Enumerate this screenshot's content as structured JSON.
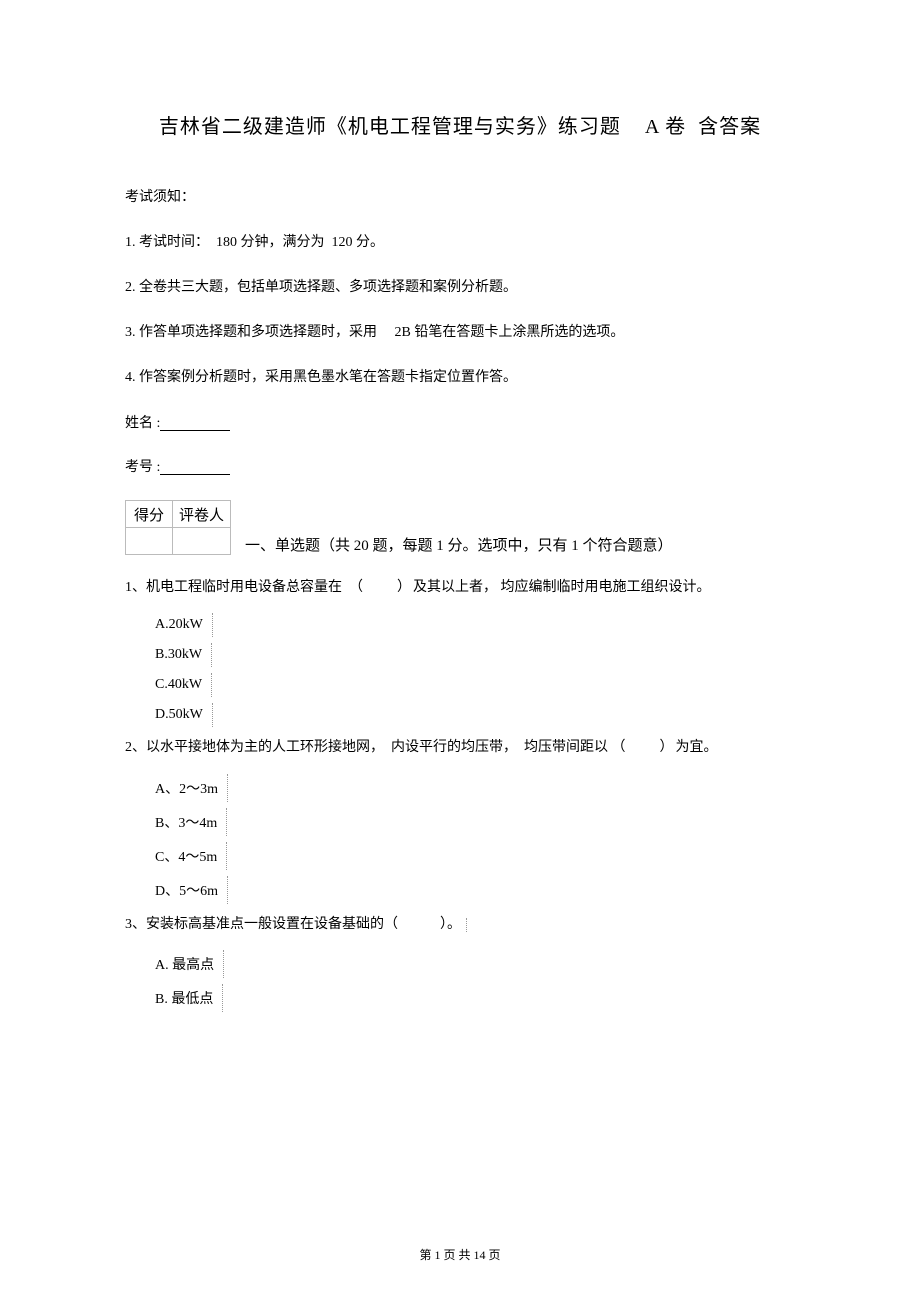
{
  "title_main": "吉林省二级建造师《机电工程管理与实务》练习题",
  "title_vol": "A 卷",
  "title_ans": "含答案",
  "notice_heading": "考试须知：",
  "notices": [
    {
      "prefix": "1. 考试时间：",
      "part1": "180 分钟，满分为",
      "part2": "120 分。"
    },
    {
      "text": "2. 全卷共三大题，包括单项选择题、多项选择题和案例分析题。"
    },
    {
      "prefix": "3. 作答单项选择题和多项选择题时，采用",
      "mid": "2B 铅笔在答题卡上涂黑所选的选项。"
    },
    {
      "text": "4. 作答案例分析题时，采用黑色墨水笔在答题卡指定位置作答。"
    }
  ],
  "name_label": "姓名 :",
  "id_label": "考号 :",
  "score_headers": [
    "得分",
    "评卷人"
  ],
  "section1_title": "一、单选题（共 20 题，每题 1 分。选项中，只有 1 个符合题意）",
  "questions": [
    {
      "no": "1、",
      "text_a": "机电工程临时用电设备总容量在",
      "blank": "（　　）",
      "text_b": "及其以上者，",
      "text_c": "均应编制临时用电施工组织设计。",
      "options": [
        "A.20kW",
        "B.30kW",
        "C.40kW",
        "D.50kW"
      ],
      "opt_dotted": true
    },
    {
      "no": "2、",
      "text_a": "以水平接地体为主的人工环形接地网，",
      "text_b": "内设平行的均压带，",
      "text_c": "均压带间距以",
      "blank": "（　　）",
      "text_d": "为宜。",
      "options": [
        "A、2～3m",
        "B、3～4m",
        "C、4～5m",
        "D、5～6m"
      ],
      "opt_dotted": true
    },
    {
      "no": "3、",
      "text_a": "安装标高基准点一般设置在设备基础的（",
      "blank_inner": "　　　",
      "text_b": "）。",
      "options": [
        "A. 最高点",
        "B. 最低点"
      ],
      "opt_dotted": true,
      "q_trailing_dot": true
    }
  ],
  "footer": {
    "prefix": "第",
    "page": "1",
    "mid": "页 共",
    "total": "14",
    "suffix": "页"
  }
}
